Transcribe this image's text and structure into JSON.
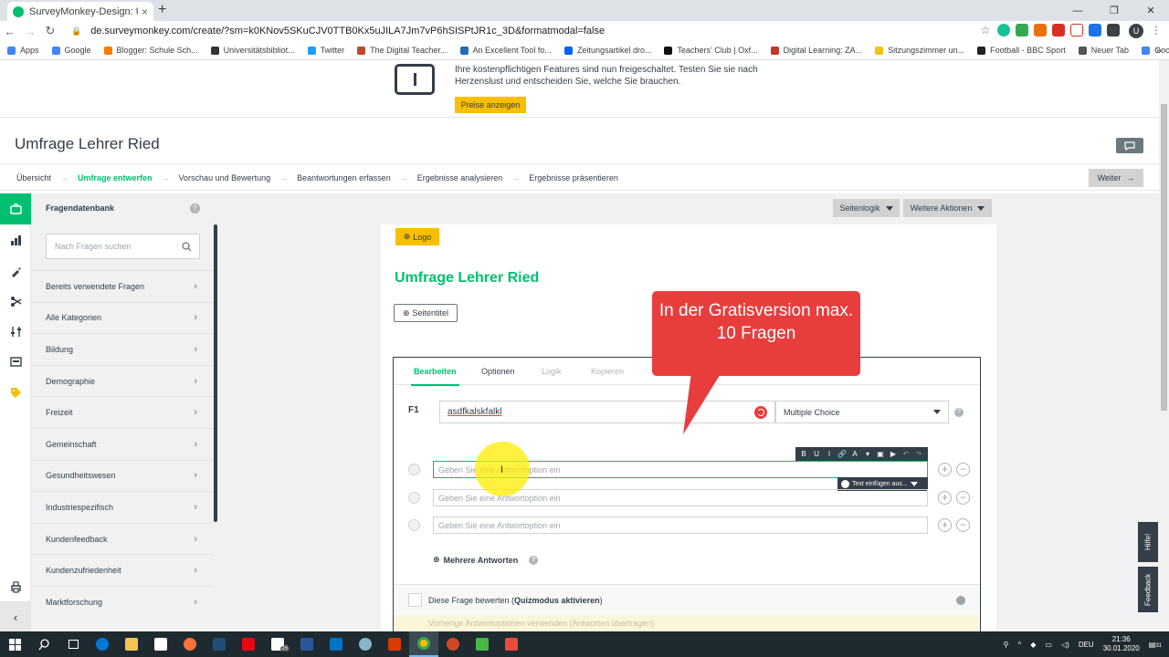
{
  "browser": {
    "tab_title": "SurveyMonkey-Design: Umfrage",
    "tab_close": "×",
    "new_tab": "+",
    "url": "de.surveymonkey.com/create/?sm=k0KNov5SKuCJV0TTB0Kx5uJILA7Jm7vP6hSIS­PtJR1c_3D&formatmodal=false",
    "bookmarks": [
      {
        "label": "Apps",
        "color": "#4285f4"
      },
      {
        "label": "Google",
        "color": "#4285f4"
      },
      {
        "label": "Blogger: Schule Sch...",
        "color": "#f57d00"
      },
      {
        "label": "Universitätsbibliot...",
        "color": "#333333"
      },
      {
        "label": "Twitter",
        "color": "#1da1f2"
      },
      {
        "label": "The Digital Teacher...",
        "color": "#b84c2c"
      },
      {
        "label": "An Excellent Tool fo...",
        "color": "#1f6fb2"
      },
      {
        "label": "Zeitungsartikel dro...",
        "color": "#0061fe"
      },
      {
        "label": "Teachers' Club | Oxf...",
        "color": "#111111"
      },
      {
        "label": "Digital Learning: ZA...",
        "color": "#c0392b"
      },
      {
        "label": "Sitzungszimmer un...",
        "color": "#f1c40f"
      },
      {
        "label": "Football - BBC Sport",
        "color": "#222222"
      },
      {
        "label": "Neuer Tab",
        "color": "#555555"
      },
      {
        "label": "Google",
        "color": "#4285f4"
      }
    ]
  },
  "banner": {
    "text": "Ihre kostenpflichtigen Features sind nun freigeschaltet. Testen Sie sie nach Herzenslust und entscheiden Sie, welche Sie brauchen.",
    "button": "Preise anzeigen"
  },
  "header": {
    "survey_title": "Umfrage Lehrer Ried",
    "steps": [
      "Übersicht",
      "Umfrage entwerfen",
      "Vorschau und Bewertung",
      "Beantwortungen erfassen",
      "Ergebnisse analysieren",
      "Ergebnisse präsentieren"
    ],
    "active_step": 1,
    "next_button": "Weiter"
  },
  "bank": {
    "title": "Fragendatenbank",
    "help": "?",
    "search_placeholder": "Nach Fragen suchen",
    "items": [
      "Bereits verwendete Fragen",
      "Alle Kategorien",
      "Bildung",
      "Demographie",
      "Freizeit",
      "Gemeinschaft",
      "Gesundheitswesen",
      "Industriespezifisch",
      "Kundenfeedback",
      "Kundenzufriedenheit",
      "Marktforschung"
    ]
  },
  "toolbar": {
    "page_logic": "Seitenlogik",
    "more_actions": "Weitere Aktionen"
  },
  "page": {
    "logo_button": "Logo",
    "title": "Umfrage Lehrer Ried",
    "page_title_button": "Seitentitel"
  },
  "question": {
    "tabs": [
      "Bearbeiten",
      "Optionen",
      "Logik",
      "Kopieren"
    ],
    "number": "F1",
    "text": "asdfkalskfalkl",
    "type": "Multiple Choice",
    "help": "?",
    "answer_placeholder": "Geben Sie eine Antwortoption ein",
    "rte_buttons": [
      "B",
      "U",
      "I",
      "🔗",
      "A",
      "▾",
      "▣",
      "▶",
      "↶",
      "↷"
    ],
    "insert_text": "Text einfügen aus...",
    "multiple_answers": "Mehrere Antworten",
    "quiz_label": "Diese Frage bewerten (",
    "quiz_bold": "Quizmodus aktivieren",
    "quiz_close": ")",
    "prev_answers": "Vorherige Antwortoptionen verwenden (Antworten übertragen)"
  },
  "callout": {
    "text": "In der Gratisversion max. 10 Fragen"
  },
  "side_tabs": {
    "help": "Hilfe!",
    "feedback": "Feedback"
  },
  "taskbar": {
    "language": "DEU",
    "time": "21:36",
    "date": "30.01.2020",
    "mail_badge": "25",
    "notif_badge": "31"
  },
  "colors": {
    "brand_green": "#00bf6f",
    "accent_yellow": "#f9be00",
    "callout_red": "#e83d3d",
    "dark": "#333e48"
  }
}
